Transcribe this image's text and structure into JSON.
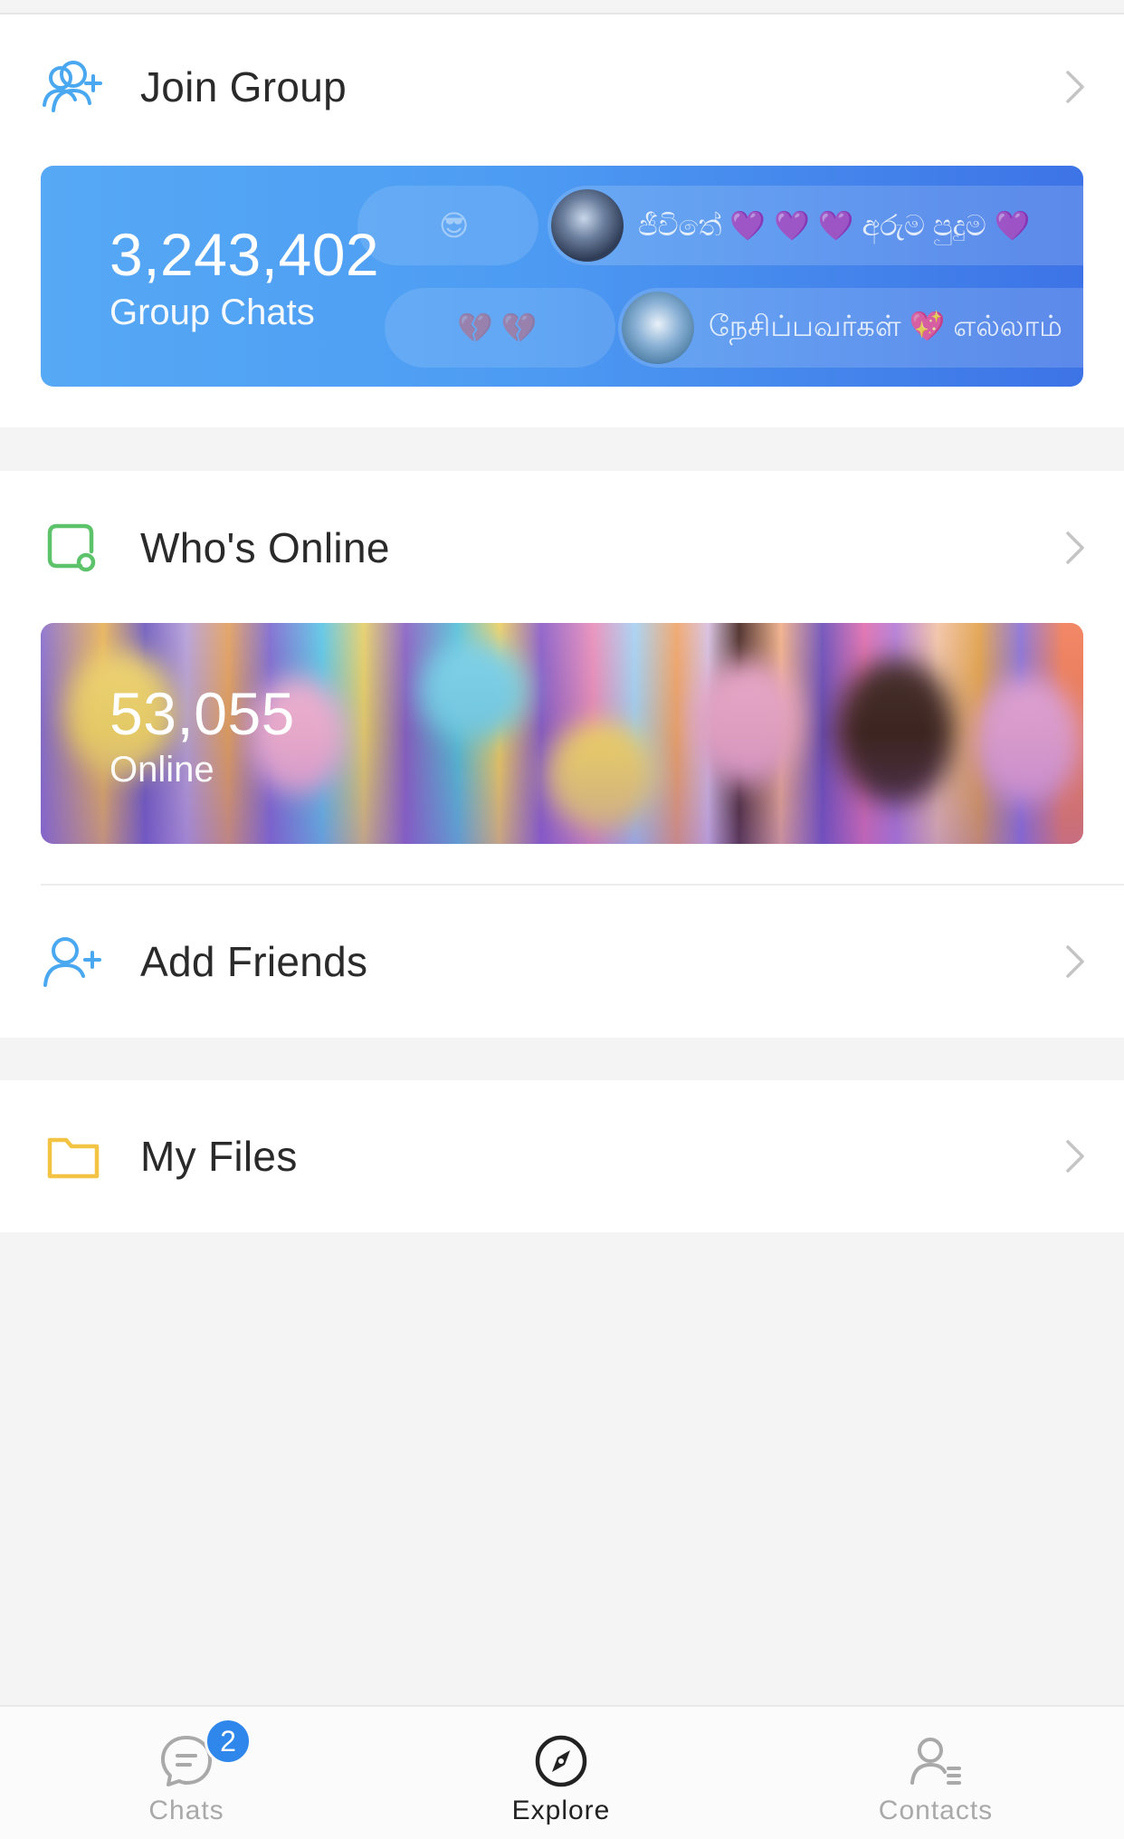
{
  "sections": {
    "join_group": {
      "label": "Join Group",
      "card": {
        "count": "3,243,402",
        "caption": "Group Chats",
        "bubbles": [
          {
            "text": "ජීවිතේ 💜 💜 💜 අරුම පුදුම 💜"
          },
          {
            "text": "நேசிப்பவர்கள் 💖 எல்லாம்"
          }
        ]
      }
    },
    "whos_online": {
      "label": "Who's Online",
      "card": {
        "count": "53,055",
        "caption": "Online"
      }
    },
    "add_friends": {
      "label": "Add Friends"
    },
    "my_files": {
      "label": "My Files"
    }
  },
  "tabbar": {
    "tabs": [
      {
        "label": "Chats",
        "badge": "2",
        "icon": "chat-bubble-icon",
        "active": false
      },
      {
        "label": "Explore",
        "icon": "compass-icon",
        "active": true
      },
      {
        "label": "Contacts",
        "icon": "contacts-icon",
        "active": false
      }
    ]
  },
  "colors": {
    "accent_blue": "#4d9cf3",
    "online_green": "#5cc36a",
    "folder_yellow": "#f3c344",
    "badge_blue": "#2f87ec",
    "tab_inactive": "#a9a9a9",
    "tab_active": "#222222"
  }
}
